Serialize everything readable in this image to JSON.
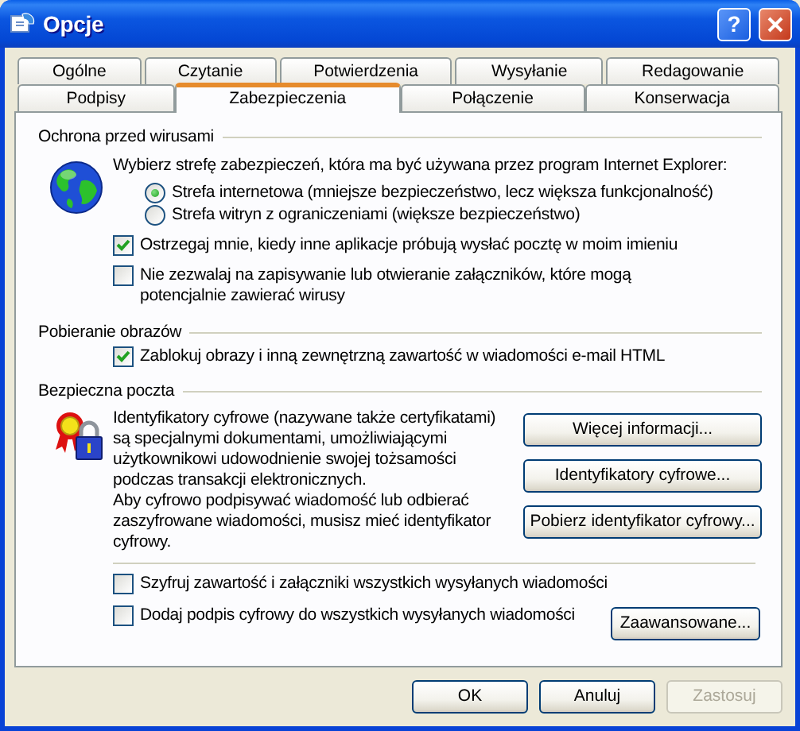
{
  "window": {
    "title": "Opcje",
    "help_button": "?"
  },
  "tab_rows": [
    [
      {
        "label": "Ogólne",
        "selected": false
      },
      {
        "label": "Czytanie",
        "selected": false
      },
      {
        "label": "Potwierdzenia",
        "selected": false
      },
      {
        "label": "Wysyłanie",
        "selected": false
      },
      {
        "label": "Redagowanie",
        "selected": false
      }
    ],
    [
      {
        "label": "Podpisy",
        "selected": false
      },
      {
        "label": "Zabezpieczenia",
        "selected": true
      },
      {
        "label": "Połączenie",
        "selected": false
      },
      {
        "label": "Konserwacja",
        "selected": false
      }
    ]
  ],
  "virus_protection": {
    "title": "Ochrona przed wirusami",
    "zone_prompt": "Wybierz strefę zabezpieczeń, która ma być używana przez program Internet Explorer:",
    "zones": [
      {
        "label": "Strefa internetowa (mniejsze bezpieczeństwo, lecz większa funkcjonalność)",
        "selected": true
      },
      {
        "label": "Strefa witryn z ograniczeniami (większe bezpieczeństwo)",
        "selected": false
      }
    ],
    "options": [
      {
        "label": "Ostrzegaj mnie, kiedy inne aplikacje próbują wysłać pocztę w moim imieniu",
        "checked": true
      },
      {
        "label": "Nie zezwalaj na zapisywanie lub otwieranie załączników, które mogą potencjalnie zawierać wirusy",
        "checked": false
      }
    ]
  },
  "image_download": {
    "title": "Pobieranie obrazów",
    "options": [
      {
        "label": "Zablokuj obrazy i inną zewnętrzną zawartość w wiadomości e-mail HTML",
        "checked": true
      }
    ]
  },
  "secure_mail": {
    "title": "Bezpieczna poczta",
    "description": [
      "Identyfikatory cyfrowe (nazywane także certyfikatami) są specjalnymi dokumentami, umożliwiającymi użytkownikowi udowodnienie swojej tożsamości podczas transakcji elektronicznych.",
      "Aby cyfrowo podpisywać wiadomość lub odbierać zaszyfrowane wiadomości, musisz mieć identyfikator cyfrowy."
    ],
    "buttons": [
      "Więcej informacji...",
      "Identyfikatory cyfrowe...",
      "Pobierz identyfikator cyfrowy..."
    ],
    "options": [
      {
        "label": "Szyfruj zawartość i załączniki wszystkich wysyłanych wiadomości",
        "checked": false
      },
      {
        "label": "Dodaj podpis cyfrowy do wszystkich wysyłanych wiadomości",
        "checked": false
      }
    ],
    "advanced_button": "Zaawansowane..."
  },
  "footer_buttons": [
    {
      "label": "OK",
      "disabled": false
    },
    {
      "label": "Anuluj",
      "disabled": false
    },
    {
      "label": "Zastosuj",
      "disabled": true
    }
  ]
}
